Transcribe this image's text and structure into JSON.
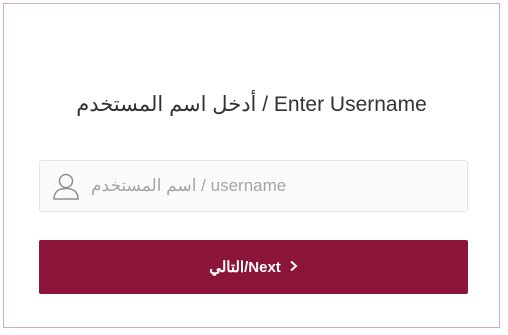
{
  "form": {
    "title": "أدخل اسم المستخدم / Enter Username",
    "username_placeholder": "اسم المستخدم / username",
    "username_value": "",
    "next_label": "التالي/Next",
    "next_icon": "chevron-right-icon",
    "user_icon": "user-icon"
  },
  "colors": {
    "accent": "#8a1538",
    "card_border": "#d3aeb8"
  }
}
